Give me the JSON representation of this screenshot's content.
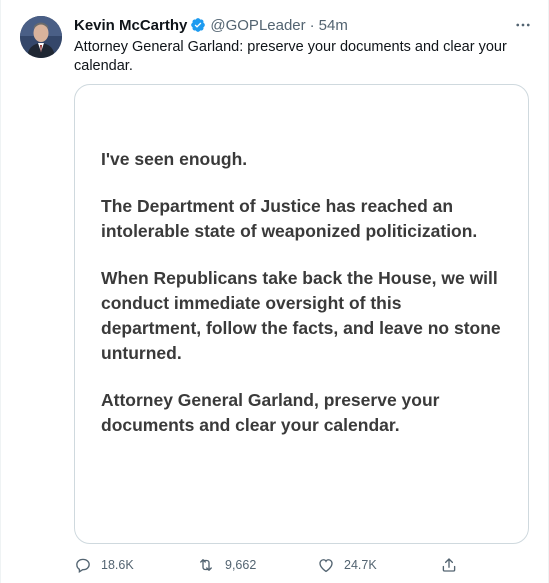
{
  "tweet": {
    "author_name": "Kevin McCarthy",
    "handle": "@GOPLeader",
    "separator": "·",
    "time": "54m",
    "text": "Attorney General Garland: preserve your documents and clear your calendar.",
    "statement": {
      "p1": "I've seen enough.",
      "p2": "The Department of Justice has reached an intolerable state of weaponized politicization.",
      "p3": "When Republicans take back the House, we will conduct immediate oversight of this department, follow the facts, and leave no stone unturned.",
      "p4": "Attorney General Garland, preserve your documents and clear your calendar."
    },
    "actions": {
      "replies": "18.6K",
      "retweets": "9,662",
      "likes": "24.7K"
    }
  },
  "colors": {
    "verified_badge": "#1d9bf0",
    "secondary_text": "#536471",
    "card_border": "#cfd9de"
  },
  "icons": [
    "more-icon",
    "verified-icon",
    "reply-icon",
    "retweet-icon",
    "like-icon",
    "share-icon"
  ]
}
